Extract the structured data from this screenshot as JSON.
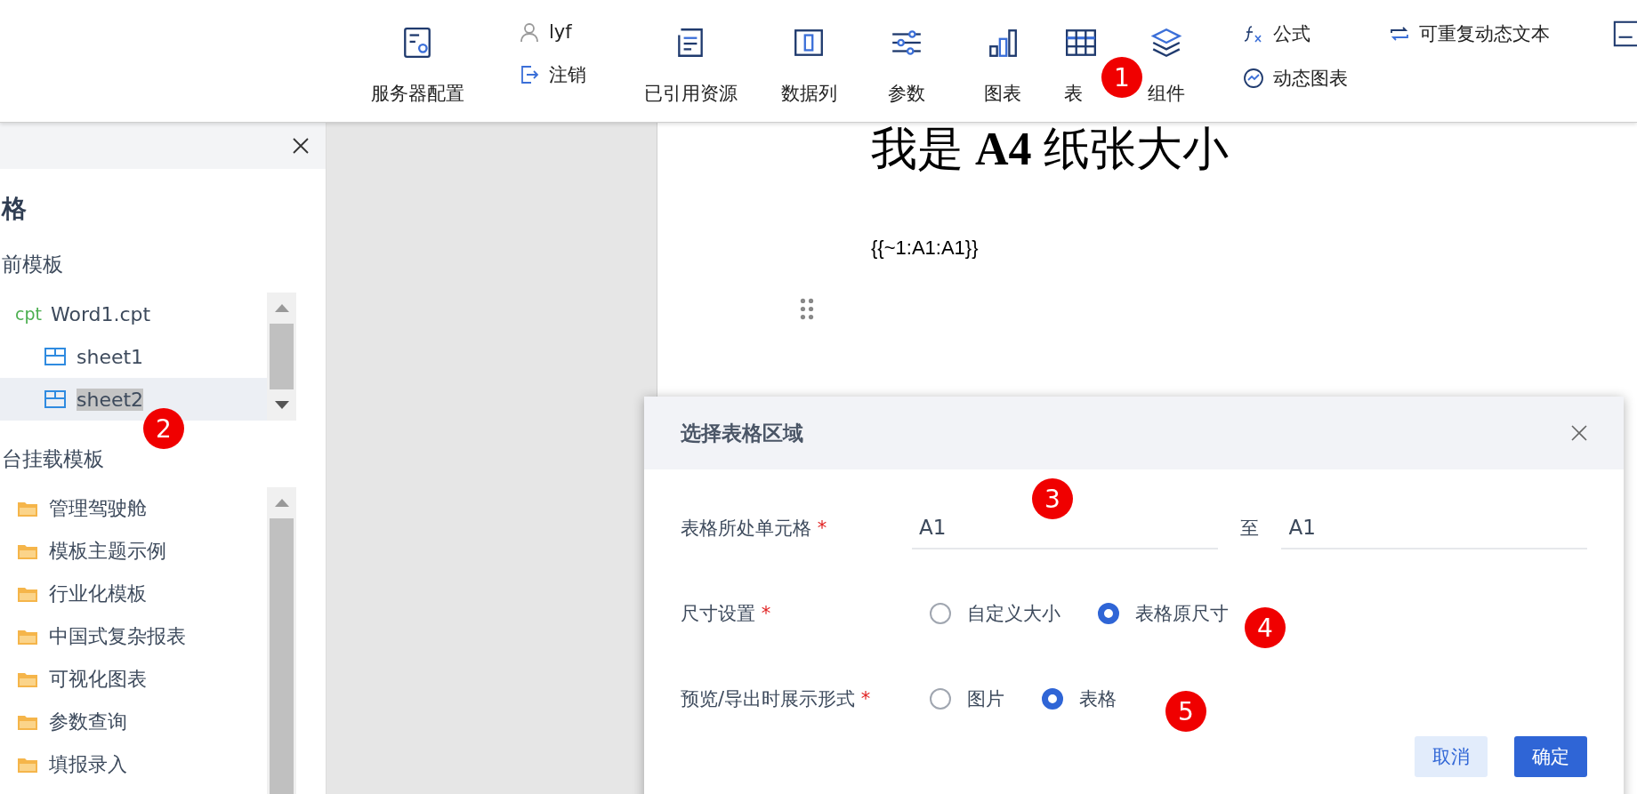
{
  "toolbar": {
    "groups": [
      [
        {
          "kind": "big",
          "label": "服务器配置"
        }
      ],
      [
        {
          "kind": "small",
          "label": "lyf"
        },
        {
          "kind": "small",
          "label": "注销"
        }
      ],
      [
        {
          "kind": "big",
          "label": "已引用资源"
        }
      ],
      [
        {
          "kind": "big",
          "label": "数据列"
        }
      ],
      [
        {
          "kind": "big",
          "label": "参数"
        }
      ],
      [
        {
          "kind": "big",
          "label": "图表"
        }
      ],
      [
        {
          "kind": "big",
          "label": "表"
        }
      ],
      [
        {
          "kind": "big",
          "label": "组件"
        }
      ],
      [
        {
          "kind": "small",
          "label": "公式"
        },
        {
          "kind": "small",
          "label": "动态图表"
        }
      ],
      [
        {
          "kind": "small",
          "label": "可重复动态文本"
        }
      ]
    ]
  },
  "side_panel": {
    "heading": "格",
    "current": {
      "title": "前模板",
      "tree": [
        {
          "tag": "cpt",
          "label": "Word1.cpt",
          "children": [
            {
              "label": "sheet1",
              "selected": false
            },
            {
              "label": "sheet2",
              "selected": true
            }
          ]
        }
      ]
    },
    "mounted": {
      "title": "台挂载模板",
      "folders": [
        {
          "label": "管理驾驶舱"
        },
        {
          "label": "模板主题示例"
        },
        {
          "label": "行业化模板"
        },
        {
          "label": "中国式复杂报表"
        },
        {
          "label": "可视化图表"
        },
        {
          "label": "参数查询"
        },
        {
          "label": "填报录入"
        }
      ]
    }
  },
  "document": {
    "title": "我是 **A4** 纸张大小",
    "field_code": "{{~1:A1:A1}}"
  },
  "dialog": {
    "title": "选择表格区域",
    "rows": [
      {
        "kind": "range",
        "label": "表格所处单元格",
        "mark": "*",
        "from": "A1",
        "separator": "至",
        "to": "A1"
      },
      {
        "kind": "radio",
        "label": "尺寸设置",
        "mark": "*",
        "options": [
          {
            "label": "自定义大小",
            "selected": false
          },
          {
            "label": "表格原尺寸",
            "selected": true
          }
        ]
      },
      {
        "kind": "radio",
        "label": "预览/导出时展示形式",
        "mark": "*",
        "options": [
          {
            "label": "图片",
            "selected": false
          },
          {
            "label": "表格",
            "selected": true
          }
        ]
      }
    ],
    "buttons": [
      {
        "kind": "secondary",
        "label": "取消"
      },
      {
        "kind": "primary",
        "label": "确定"
      }
    ]
  },
  "callouts": [
    {
      "label": "1"
    },
    {
      "label": "2"
    },
    {
      "label": "3"
    },
    {
      "label": "4"
    },
    {
      "label": "5"
    }
  ]
}
